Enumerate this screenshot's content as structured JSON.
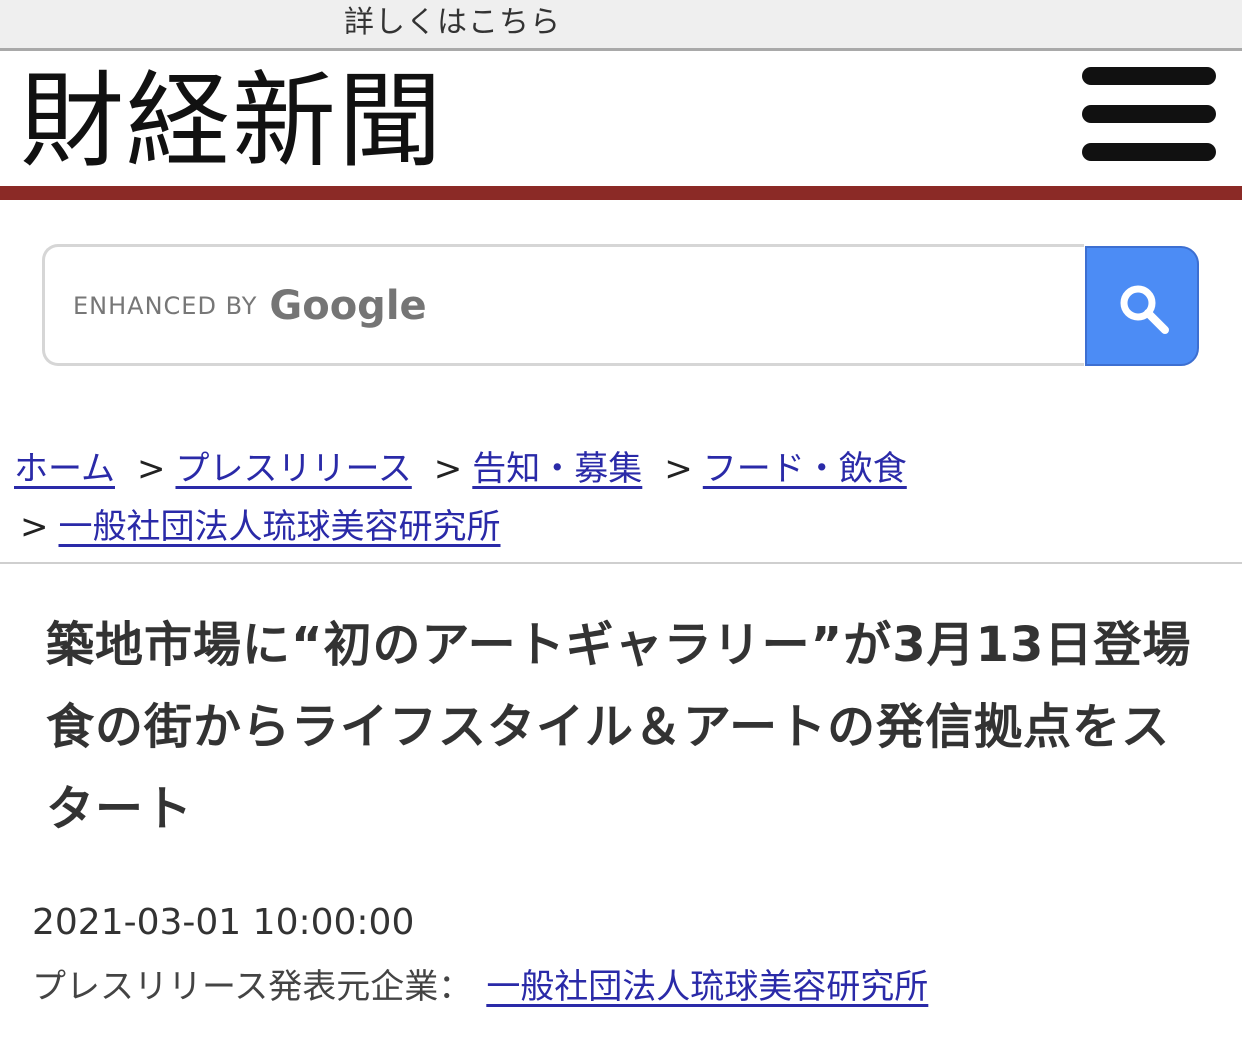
{
  "banner": {
    "link_text": "詳しくはこちら"
  },
  "header": {
    "logo_text": "財経新聞",
    "menu_icon": "hamburger-menu-icon",
    "accent_color": "#8b2a26"
  },
  "search": {
    "placeholder": "",
    "brand_small": "ENHANCED BY",
    "brand_big": "Google",
    "button_icon": "search-icon",
    "button_color": "#4c8cf5"
  },
  "breadcrumb": {
    "separator": ">",
    "items": [
      {
        "label": "ホーム"
      },
      {
        "label": "プレスリリース"
      },
      {
        "label": "告知・募集"
      },
      {
        "label": "フード・飲食"
      },
      {
        "label": "一般社団法人琉球美容研究所"
      }
    ]
  },
  "article": {
    "title": "築地市場に“初のアートギャラリー”が3月13日登場　食の街からライフスタイル＆アートの発信拠点をスタート",
    "date": "2021-03-01 10:00:00",
    "publisher_label": "プレスリリース発表元企業：",
    "publisher_name": "一般社団法人琉球美容研究所",
    "link_color": "#2a2aa8"
  }
}
